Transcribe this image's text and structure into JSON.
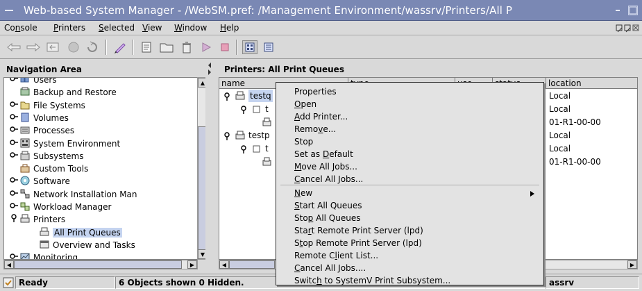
{
  "window": {
    "title": "Web-based System Manager - /WebSM.pref: /Management Environment/wassrv/Printers/All P"
  },
  "menubar": {
    "items": [
      {
        "pre": "Co",
        "key": "n",
        "post": "sole"
      },
      {
        "pre": "",
        "key": "P",
        "post": "rinters"
      },
      {
        "pre": "",
        "key": "S",
        "post": "elected"
      },
      {
        "pre": "",
        "key": "V",
        "post": "iew"
      },
      {
        "pre": "",
        "key": "W",
        "post": "indow"
      },
      {
        "pre": "",
        "key": "H",
        "post": "elp"
      }
    ]
  },
  "toolbar": {
    "buttons": [
      "back-icon",
      "forward-icon",
      "up-level-icon",
      "stop-icon",
      "reload-icon",
      "edit-icon",
      "properties-icon",
      "open-icon",
      "delete-icon",
      "start-icon",
      "stop-queue-icon",
      "large-icons-view-icon",
      "details-view-icon"
    ]
  },
  "nav": {
    "header": "Navigation Area",
    "items": [
      {
        "label": "Users",
        "exp": "o",
        "icon": "users-icon",
        "indent": 1
      },
      {
        "label": "Backup and Restore",
        "exp": "",
        "icon": "backup-icon",
        "indent": 1
      },
      {
        "label": "File Systems",
        "exp": "o",
        "icon": "filesystem-icon",
        "indent": 1
      },
      {
        "label": "Volumes",
        "exp": "o",
        "icon": "volumes-icon",
        "indent": 1
      },
      {
        "label": "Processes",
        "exp": "o",
        "icon": "processes-icon",
        "indent": 1
      },
      {
        "label": "System Environment",
        "exp": "o",
        "icon": "system-environment-icon",
        "indent": 1
      },
      {
        "label": "Subsystems",
        "exp": "o",
        "icon": "subsystems-icon",
        "indent": 1
      },
      {
        "label": "Custom Tools",
        "exp": "",
        "icon": "custom-tools-icon",
        "indent": 1
      },
      {
        "label": "Software",
        "exp": "o",
        "icon": "software-icon",
        "indent": 1
      },
      {
        "label": "Network Installation Man",
        "exp": "o",
        "icon": "network-installation-icon",
        "indent": 1
      },
      {
        "label": "Workload Manager",
        "exp": "o",
        "icon": "workload-manager-icon",
        "indent": 1
      },
      {
        "label": "Printers",
        "exp": "v",
        "icon": "printer-icon",
        "indent": 1
      },
      {
        "label": "All Print Queues",
        "exp": "",
        "icon": "print-queue-icon",
        "indent": 2,
        "selected": true
      },
      {
        "label": "Overview and Tasks",
        "exp": "",
        "icon": "overview-icon",
        "indent": 2
      },
      {
        "label": "Monitoring",
        "exp": "o",
        "icon": "monitoring-icon",
        "indent": 1
      }
    ]
  },
  "content": {
    "header": "Printers: All Print Queues",
    "columns": [
      "name",
      "type",
      "use",
      "status",
      "location"
    ],
    "rows": [
      {
        "name": "testq",
        "location": "Local",
        "level": 0
      },
      {
        "name": "t",
        "location": "Local",
        "level": 1
      },
      {
        "name": "",
        "location": "01-R1-00-00",
        "level": 2
      },
      {
        "name": "testp",
        "location": "Local",
        "level": 0
      },
      {
        "name": "t",
        "location": "Local",
        "level": 1
      },
      {
        "name": "",
        "location": "01-R1-00-00",
        "level": 2
      }
    ]
  },
  "context_menu": {
    "group1": [
      {
        "pre": "Properties",
        "key": "",
        "post": ""
      },
      {
        "pre": "",
        "key": "O",
        "post": "pen"
      },
      {
        "pre": "",
        "key": "A",
        "post": "dd Printer..."
      },
      {
        "pre": "Remo",
        "key": "v",
        "post": "e..."
      },
      {
        "pre": "Stop",
        "key": "",
        "post": ""
      },
      {
        "pre": "Set as ",
        "key": "D",
        "post": "efault"
      },
      {
        "pre": "",
        "key": "M",
        "post": "ove All Jobs..."
      },
      {
        "pre": "",
        "key": "C",
        "post": "ancel All Jobs..."
      }
    ],
    "group2": [
      {
        "pre": "",
        "key": "N",
        "post": "ew",
        "submenu": true
      },
      {
        "pre": "",
        "key": "S",
        "post": "tart All Queues"
      },
      {
        "pre": "Sto",
        "key": "p",
        "post": " All Queues"
      },
      {
        "pre": "Sta",
        "key": "r",
        "post": "t Remote Print Server (lpd)"
      },
      {
        "pre": "S",
        "key": "t",
        "post": "op Remote Print Server (lpd)"
      },
      {
        "pre": "Remote C",
        "key": "l",
        "post": "ient List..."
      },
      {
        "pre": "",
        "key": "C",
        "post": "ancel All Jobs...."
      },
      {
        "pre": "Switc",
        "key": "h",
        "post": " to SystemV Print Subsystem..."
      }
    ]
  },
  "status": {
    "ready": "Ready",
    "objects": "6 Objects shown 0 Hidden.",
    "host": "assrv"
  }
}
